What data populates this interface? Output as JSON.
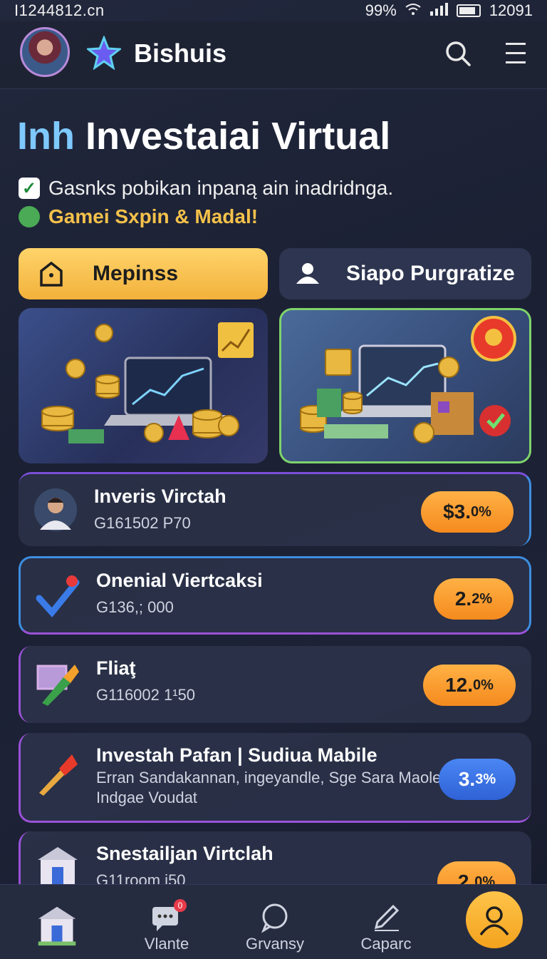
{
  "status": {
    "carrier_text": "I1244812.cn",
    "battery": "99%",
    "time": "12091"
  },
  "header": {
    "brand": "Bishuis",
    "icons": [
      "avatar",
      "star-logo-icon",
      "search-icon",
      "menu-icon"
    ]
  },
  "hero": {
    "title_prefix": "Inh",
    "title_main": "Investaiai Virtual",
    "line1": "Gasnks pobikan inpaną ain inadridnga.",
    "line2": "Gamei Sxpin & Madal!"
  },
  "buttons": {
    "primary": "Mepinss",
    "secondary": "Siapo Purgratize"
  },
  "list": [
    {
      "title": "Inveris Virctah",
      "subtitle": "G161502 P70",
      "badge_main": "$3.",
      "badge_small": "0%",
      "icon": "portrait-icon"
    },
    {
      "title": "Onenial Viertcaksi",
      "subtitle": "G136,; 000",
      "badge_main": "2.",
      "badge_small": "2%",
      "icon": "check-icon"
    },
    {
      "title": "Fliaţ",
      "subtitle": "G116002 1¹50",
      "badge_main": "12.",
      "badge_small": "0%",
      "icon": "brush-icon"
    },
    {
      "title": "Investah Pafan | Sudiua Mabile",
      "subtitle": "Erran Sandakannan, ingeyandle, Sge Sara Maole-",
      "subtitle2": "Indgae Voudat",
      "badge_main": "3.",
      "badge_small": "3%",
      "icon": "torch-icon"
    },
    {
      "title": "Snestailjan Virtclah",
      "subtitle": "G11room i50",
      "badge_main": "2.",
      "badge_small": "0%",
      "icon": "bank-icon"
    }
  ],
  "nav": {
    "items": [
      "Vlante",
      "Grvansy",
      "Caparc"
    ],
    "notification_badge": "0"
  },
  "colors": {
    "accent": "#f5b13b",
    "primary_bg": "#1d2236",
    "blue_pill": "#3a72e6"
  }
}
